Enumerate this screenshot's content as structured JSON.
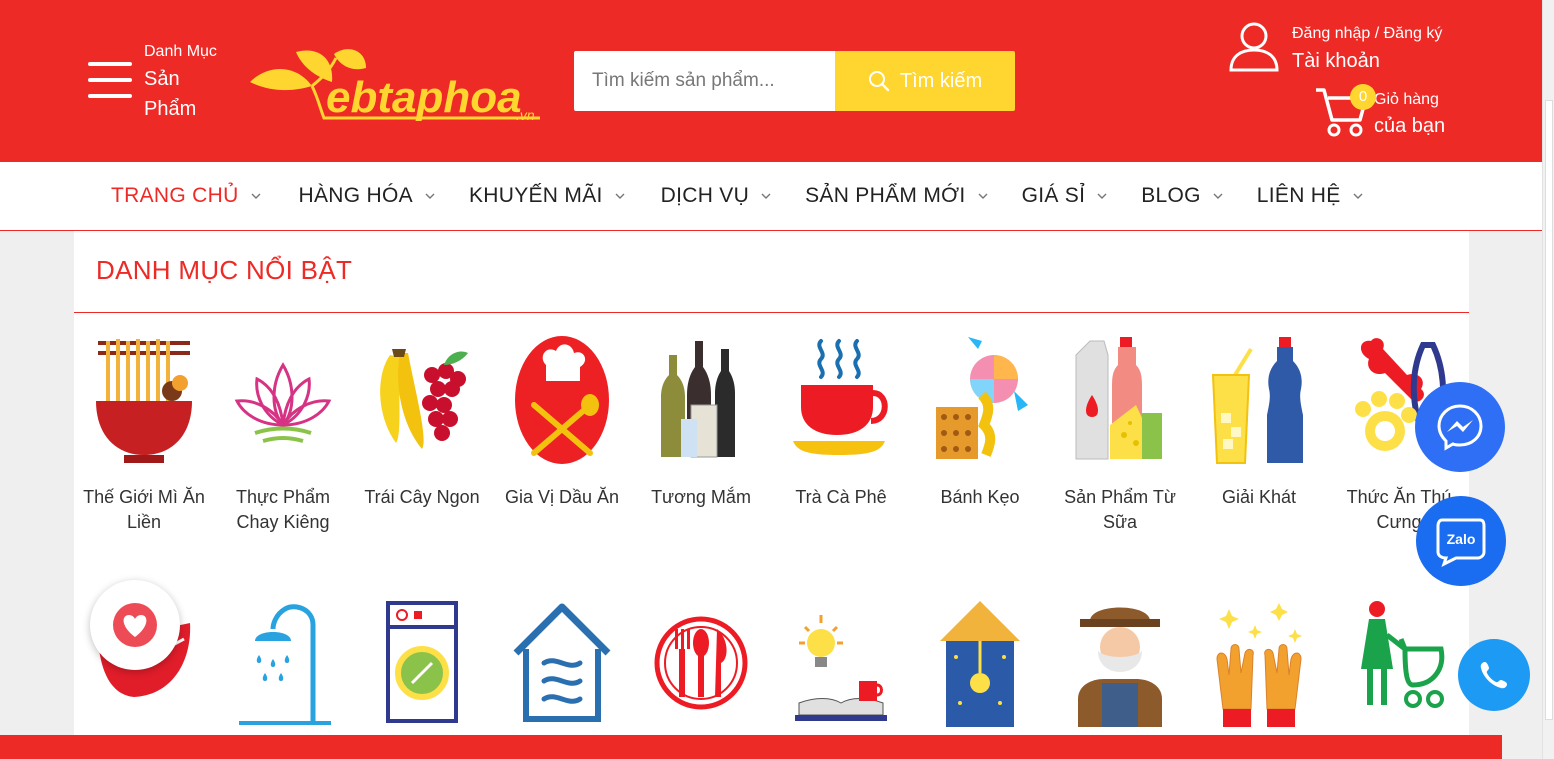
{
  "header": {
    "menu_small": "Danh Mục",
    "menu_big": "Sản Phẩm",
    "logo_text": "ebtaphoa",
    "logo_domain": ".vn",
    "search_placeholder": "Tìm kiếm sản phẩm...",
    "search_button": "Tìm kiếm",
    "account_small": "Đăng nhập / Đăng ký",
    "account_big": "Tài khoản",
    "cart_count": "0",
    "cart_small": "Giỏ hàng",
    "cart_big": "của bạn"
  },
  "nav": [
    {
      "label": "TRANG CHỦ",
      "active": true
    },
    {
      "label": "HÀNG HÓA"
    },
    {
      "label": "KHUYẾN MÃI"
    },
    {
      "label": "DỊCH VỤ"
    },
    {
      "label": "SẢN PHẨM MỚI"
    },
    {
      "label": "GIÁ SỈ"
    },
    {
      "label": "BLOG"
    },
    {
      "label": "LIÊN HỆ"
    }
  ],
  "section": {
    "title": "DANH MỤC NỔI BẬT",
    "row1": [
      {
        "label": "Thế Giới Mì Ăn Liền",
        "icon": "noodle-bowl-icon"
      },
      {
        "label": "Thực Phẩm Chay Kiêng",
        "icon": "lotus-icon"
      },
      {
        "label": "Trái Cây Ngon",
        "icon": "fruit-icon"
      },
      {
        "label": "Gia Vị Dầu Ăn",
        "icon": "chef-spoon-icon"
      },
      {
        "label": "Tương Mắm",
        "icon": "bottles-icon"
      },
      {
        "label": "Trà Cà Phê",
        "icon": "coffee-cup-icon"
      },
      {
        "label": "Bánh Kẹo",
        "icon": "candy-icon"
      },
      {
        "label": "Sản Phẩm Từ Sữa",
        "icon": "milk-icon"
      },
      {
        "label": "Giải Khát",
        "icon": "drink-icon"
      },
      {
        "label": "Thức Ăn Thú Cưng",
        "icon": "pet-food-icon"
      }
    ],
    "row2": [
      {
        "icon": "lips-icon"
      },
      {
        "icon": "shower-icon"
      },
      {
        "icon": "washing-machine-icon"
      },
      {
        "icon": "house-heating-icon"
      },
      {
        "icon": "cutlery-plate-icon"
      },
      {
        "icon": "lamp-book-icon"
      },
      {
        "icon": "wall-lamp-icon"
      },
      {
        "icon": "old-farmer-icon"
      },
      {
        "icon": "sparkle-hands-icon"
      },
      {
        "icon": "mother-baby-icon"
      }
    ]
  },
  "colors": {
    "brand_red": "#ed2a26",
    "brand_yellow": "#ffd530",
    "messenger_blue": "#2e6ff5",
    "zalo_blue": "#1a6cf0",
    "phone_blue": "#1d9af3"
  }
}
